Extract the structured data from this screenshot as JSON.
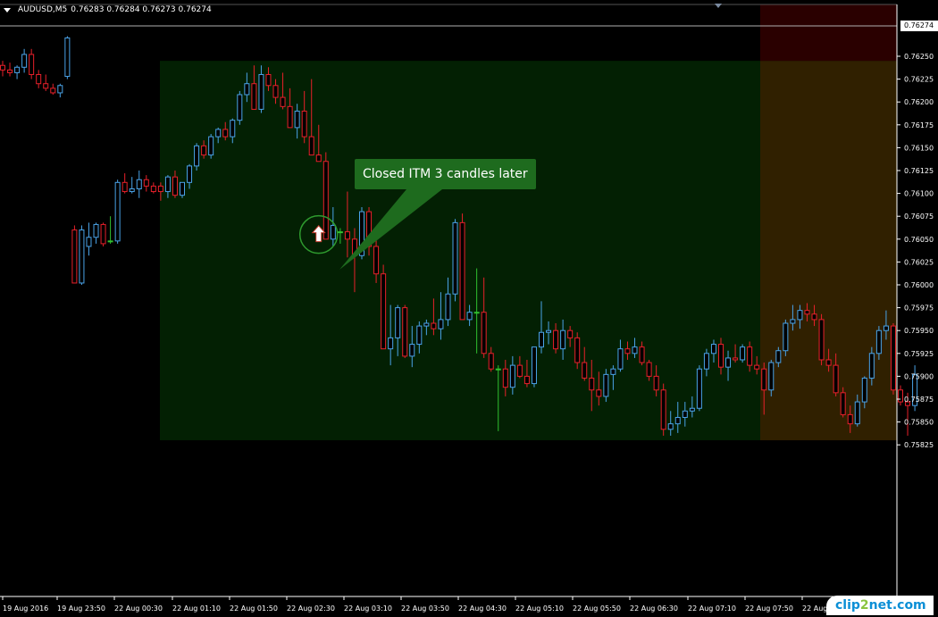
{
  "header": {
    "symbol": "AUDUSD,M5",
    "ohlc": "0.76283 0.76284 0.76273 0.76274"
  },
  "current_price_label": "0.76274",
  "annotation": {
    "text": "Closed ITM 3 candles later"
  },
  "watermark": {
    "part1": "clip",
    "part2": "2",
    "part3": "net.com"
  },
  "colors": {
    "background": "#000000",
    "bull": "#4aa3e8",
    "bear": "#e8202a",
    "doji": "#30c030",
    "zone_green": "#032003",
    "zone_brown": "#302000",
    "zone_red": "#2a0000",
    "callout": "#1e6b1e",
    "grid_text": "#ffffff"
  },
  "y_axis": {
    "min": 0.7582,
    "max": 0.76285,
    "ticks": [
      "0.76250",
      "0.76225",
      "0.76200",
      "0.76175",
      "0.76150",
      "0.76125",
      "0.76100",
      "0.76075",
      "0.76050",
      "0.76025",
      "0.76000",
      "0.75975",
      "0.75950",
      "0.75925",
      "0.75900",
      "0.75875",
      "0.75850",
      "0.75825"
    ]
  },
  "x_axis": {
    "ticks": [
      "19 Aug 2016",
      "19 Aug 23:50",
      "22 Aug 00:30",
      "22 Aug 01:10",
      "22 Aug 01:50",
      "22 Aug 02:30",
      "22 Aug 03:10",
      "22 Aug 03:50",
      "22 Aug 04:30",
      "22 Aug 05:10",
      "22 Aug 05:50",
      "22 Aug 06:30",
      "22 Aug 07:10",
      "22 Aug 07:50",
      "22 Aug 08:30"
    ]
  },
  "chart_data": {
    "type": "candlestick",
    "symbol": "AUDUSD",
    "timeframe": "M5",
    "zones": [
      {
        "name": "green",
        "from_candle": 22,
        "to_candle": 103,
        "price_range": [
          0.7583,
          0.76245
        ]
      },
      {
        "name": "brown",
        "from_candle": 103,
        "to_candle": 120,
        "price_range": [
          0.7583,
          0.76245
        ]
      },
      {
        "name": "red",
        "from_candle": 103,
        "to_candle": 120,
        "price_range": [
          0.76245,
          0.76285
        ]
      }
    ],
    "signal": {
      "candle": 43,
      "price": 0.76055,
      "direction": "up"
    },
    "candles": [
      [
        0.7624,
        0.76245,
        0.76228,
        0.76235
      ],
      [
        0.76235,
        0.76243,
        0.76228,
        0.76232
      ],
      [
        0.76232,
        0.7624,
        0.76225,
        0.76238
      ],
      [
        0.76238,
        0.76258,
        0.76232,
        0.76252
      ],
      [
        0.76252,
        0.76258,
        0.76225,
        0.7623
      ],
      [
        0.7623,
        0.76235,
        0.76215,
        0.7622
      ],
      [
        0.7622,
        0.7623,
        0.76212,
        0.76215
      ],
      [
        0.76215,
        0.7622,
        0.76208,
        0.7621
      ],
      [
        0.7621,
        0.7622,
        0.76205,
        0.76218
      ],
      [
        0.76228,
        0.76272,
        0.76225,
        0.7627
      ],
      [
        0.7606,
        0.76065,
        0.76002,
        0.76002
      ],
      [
        0.76002,
        0.76065,
        0.76,
        0.7606
      ],
      [
        0.76042,
        0.76068,
        0.76032,
        0.76052
      ],
      [
        0.76052,
        0.76068,
        0.76045,
        0.76066
      ],
      [
        0.76066,
        0.76068,
        0.76042,
        0.76045
      ],
      [
        0.76048,
        0.76075,
        0.76045,
        0.76048
      ],
      [
        0.76048,
        0.76115,
        0.76045,
        0.76112
      ],
      [
        0.76112,
        0.76122,
        0.761,
        0.76102
      ],
      [
        0.76102,
        0.76118,
        0.761,
        0.76105
      ],
      [
        0.76105,
        0.76125,
        0.76095,
        0.76115
      ],
      [
        0.76115,
        0.7612,
        0.76102,
        0.76108
      ],
      [
        0.76108,
        0.76112,
        0.761,
        0.76102
      ],
      [
        0.76108,
        0.76112,
        0.76092,
        0.76102
      ],
      [
        0.76102,
        0.7612,
        0.76095,
        0.76118
      ],
      [
        0.76118,
        0.76125,
        0.76095,
        0.76098
      ],
      [
        0.76098,
        0.76112,
        0.76095,
        0.76112
      ],
      [
        0.76112,
        0.76132,
        0.76105,
        0.7613
      ],
      [
        0.7613,
        0.76155,
        0.76125,
        0.76152
      ],
      [
        0.76152,
        0.76158,
        0.76138,
        0.76142
      ],
      [
        0.76142,
        0.76165,
        0.76138,
        0.76162
      ],
      [
        0.76162,
        0.76172,
        0.76155,
        0.7617
      ],
      [
        0.7617,
        0.76178,
        0.76158,
        0.76162
      ],
      [
        0.76162,
        0.76182,
        0.76155,
        0.7618
      ],
      [
        0.7618,
        0.76212,
        0.76175,
        0.76208
      ],
      [
        0.76208,
        0.76232,
        0.762,
        0.7622
      ],
      [
        0.7622,
        0.7624,
        0.76192,
        0.76192
      ],
      [
        0.76192,
        0.7624,
        0.76188,
        0.7623
      ],
      [
        0.7623,
        0.76238,
        0.76212,
        0.76218
      ],
      [
        0.76218,
        0.76225,
        0.76198,
        0.76205
      ],
      [
        0.76205,
        0.76232,
        0.76192,
        0.76195
      ],
      [
        0.76195,
        0.76215,
        0.76172,
        0.76172
      ],
      [
        0.76172,
        0.76198,
        0.7616,
        0.7619
      ],
      [
        0.7619,
        0.76212,
        0.76155,
        0.76162
      ],
      [
        0.76162,
        0.76225,
        0.76142,
        0.76142
      ],
      [
        0.76142,
        0.76175,
        0.76135,
        0.76135
      ],
      [
        0.76135,
        0.76145,
        0.7605,
        0.7605
      ],
      [
        0.7605,
        0.76085,
        0.76042,
        0.76065
      ],
      [
        0.76058,
        0.76062,
        0.76045,
        0.76058
      ],
      [
        0.76058,
        0.76102,
        0.7603,
        0.7605
      ],
      [
        0.7605,
        0.76062,
        0.75992,
        0.76032
      ],
      [
        0.76032,
        0.76085,
        0.76028,
        0.7608
      ],
      [
        0.7608,
        0.76085,
        0.76032,
        0.76042
      ],
      [
        0.76042,
        0.76052,
        0.76002,
        0.76012
      ],
      [
        0.76012,
        0.76022,
        0.7593,
        0.7593
      ],
      [
        0.7593,
        0.75978,
        0.75912,
        0.75942
      ],
      [
        0.75942,
        0.75978,
        0.75922,
        0.75975
      ],
      [
        0.75975,
        0.75978,
        0.7592,
        0.75922
      ],
      [
        0.75922,
        0.75955,
        0.7591,
        0.75935
      ],
      [
        0.75935,
        0.7596,
        0.75925,
        0.75955
      ],
      [
        0.75955,
        0.75962,
        0.75945,
        0.75958
      ],
      [
        0.75958,
        0.75985,
        0.75945,
        0.75952
      ],
      [
        0.75952,
        0.75992,
        0.7594,
        0.75962
      ],
      [
        0.75962,
        0.76008,
        0.75955,
        0.7599
      ],
      [
        0.7599,
        0.76072,
        0.75982,
        0.76068
      ],
      [
        0.76068,
        0.76078,
        0.75962,
        0.75962
      ],
      [
        0.75962,
        0.75978,
        0.75955,
        0.7597
      ],
      [
        0.7597,
        0.76018,
        0.75925,
        0.7597
      ],
      [
        0.7597,
        0.76008,
        0.7592,
        0.75925
      ],
      [
        0.75925,
        0.75932,
        0.75905,
        0.75908
      ],
      [
        0.75908,
        0.75912,
        0.7584,
        0.75908
      ],
      [
        0.75908,
        0.75918,
        0.75878,
        0.75888
      ],
      [
        0.75888,
        0.75922,
        0.7588,
        0.75912
      ],
      [
        0.75912,
        0.75922,
        0.75898,
        0.759
      ],
      [
        0.759,
        0.75918,
        0.75888,
        0.75892
      ],
      [
        0.75892,
        0.75932,
        0.75888,
        0.75932
      ],
      [
        0.75932,
        0.75982,
        0.75925,
        0.75948
      ],
      [
        0.75948,
        0.7596,
        0.75935,
        0.7595
      ],
      [
        0.7595,
        0.75958,
        0.75925,
        0.7593
      ],
      [
        0.7593,
        0.75962,
        0.75918,
        0.7595
      ],
      [
        0.7595,
        0.75955,
        0.75932,
        0.75942
      ],
      [
        0.75942,
        0.75948,
        0.75908,
        0.75915
      ],
      [
        0.75915,
        0.75932,
        0.75895,
        0.75898
      ],
      [
        0.75898,
        0.75918,
        0.75862,
        0.75885
      ],
      [
        0.75885,
        0.75905,
        0.75868,
        0.75878
      ],
      [
        0.75878,
        0.75908,
        0.75872,
        0.75902
      ],
      [
        0.75902,
        0.75912,
        0.75885,
        0.75908
      ],
      [
        0.75908,
        0.7594,
        0.75905,
        0.7593
      ],
      [
        0.7593,
        0.75938,
        0.75918,
        0.75925
      ],
      [
        0.75925,
        0.75942,
        0.7592,
        0.75932
      ],
      [
        0.75932,
        0.75938,
        0.75912,
        0.75915
      ],
      [
        0.75915,
        0.75918,
        0.75895,
        0.759
      ],
      [
        0.759,
        0.75912,
        0.75878,
        0.75885
      ],
      [
        0.75885,
        0.75892,
        0.75835,
        0.75842
      ],
      [
        0.75842,
        0.75862,
        0.75835,
        0.75848
      ],
      [
        0.75848,
        0.75872,
        0.75838,
        0.75855
      ],
      [
        0.75855,
        0.75872,
        0.75845,
        0.75862
      ],
      [
        0.75862,
        0.75878,
        0.75855,
        0.75865
      ],
      [
        0.75865,
        0.75912,
        0.75862,
        0.75908
      ],
      [
        0.75908,
        0.7593,
        0.759,
        0.75925
      ],
      [
        0.75925,
        0.7594,
        0.75915,
        0.75935
      ],
      [
        0.75935,
        0.75942,
        0.75902,
        0.7591
      ],
      [
        0.7591,
        0.75928,
        0.75895,
        0.7592
      ],
      [
        0.7592,
        0.75935,
        0.75915,
        0.75918
      ],
      [
        0.75918,
        0.75935,
        0.75915,
        0.75932
      ],
      [
        0.75932,
        0.75938,
        0.75905,
        0.75912
      ],
      [
        0.75912,
        0.75922,
        0.75902,
        0.75908
      ],
      [
        0.75908,
        0.75915,
        0.75858,
        0.75885
      ],
      [
        0.75885,
        0.75918,
        0.75878,
        0.75915
      ],
      [
        0.75915,
        0.75932,
        0.7591,
        0.75928
      ],
      [
        0.75928,
        0.75962,
        0.75922,
        0.75958
      ],
      [
        0.75958,
        0.75978,
        0.7595,
        0.75962
      ],
      [
        0.75962,
        0.75978,
        0.75952,
        0.75972
      ],
      [
        0.75972,
        0.7598,
        0.7596,
        0.75968
      ],
      [
        0.75968,
        0.75978,
        0.75955,
        0.75962
      ],
      [
        0.75962,
        0.75968,
        0.75912,
        0.75918
      ],
      [
        0.75918,
        0.7593,
        0.75905,
        0.75912
      ],
      [
        0.75912,
        0.75925,
        0.75878,
        0.75882
      ],
      [
        0.75882,
        0.75888,
        0.75855,
        0.75858
      ],
      [
        0.75858,
        0.75868,
        0.75838,
        0.75848
      ],
      [
        0.75848,
        0.7588,
        0.75845,
        0.75872
      ],
      [
        0.75872,
        0.759,
        0.75865,
        0.75898
      ],
      [
        0.75898,
        0.75932,
        0.7589,
        0.75925
      ],
      [
        0.75925,
        0.75955,
        0.75918,
        0.7595
      ],
      [
        0.7595,
        0.75972,
        0.7594,
        0.75955
      ],
      [
        0.75955,
        0.75958,
        0.7588,
        0.75885
      ],
      [
        0.75885,
        0.7589,
        0.75868,
        0.75872
      ],
      [
        0.75872,
        0.75882,
        0.75835,
        0.75868
      ],
      [
        0.75868,
        0.75912,
        0.75862,
        0.75902
      ]
    ]
  }
}
